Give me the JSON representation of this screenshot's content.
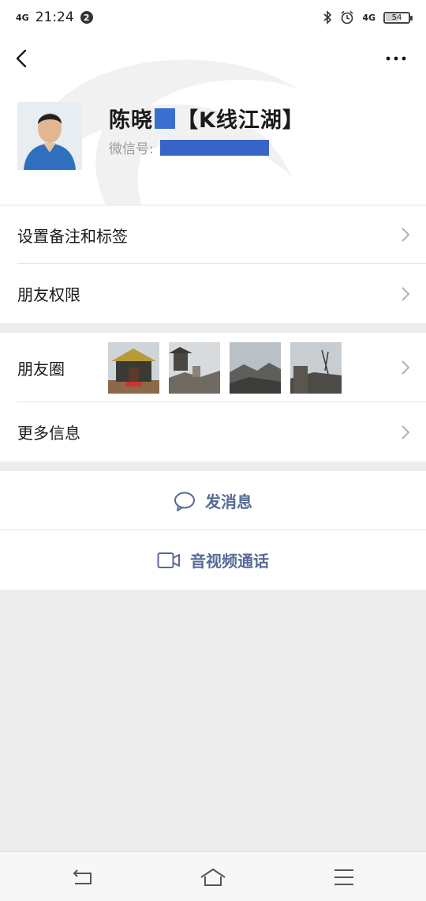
{
  "status_bar": {
    "network_left": "4G",
    "time": "21:24",
    "notification_count": "2",
    "network_right": "4G",
    "battery_level": "54",
    "battery_percent": 54
  },
  "header": {
    "name_part1": "陈晓",
    "name_part2": "【K线江湖】",
    "wechat_id_label": "微信号:"
  },
  "rows": {
    "remark_tags": "设置备注和标签",
    "friend_permissions": "朋友权限",
    "moments": "朋友圈",
    "more_info": "更多信息"
  },
  "actions": {
    "send_message": "发消息",
    "video_call": "音视频通话"
  },
  "icons": {
    "back": "back-chevron-icon",
    "more": "more-dots-icon",
    "chevron": "chevron-right-icon",
    "message": "message-bubble-icon",
    "video": "video-camera-icon",
    "nav_back": "nav-back-icon",
    "nav_home": "nav-home-icon",
    "nav_menu": "nav-menu-icon"
  },
  "colors": {
    "accent_link": "#576b95",
    "background": "#ededed",
    "surface": "#ffffff"
  }
}
